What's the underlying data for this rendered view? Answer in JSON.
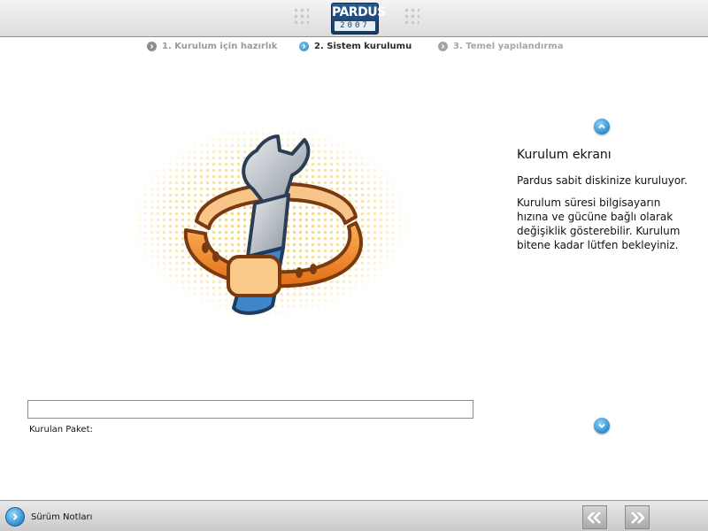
{
  "header": {
    "logo_name": "PARDUS",
    "logo_year": "2007"
  },
  "steps": [
    {
      "label": "1. Kurulum için hazırlık",
      "state": "done"
    },
    {
      "label": "2. Sistem kurulumu",
      "state": "active"
    },
    {
      "label": "3. Temel yapılandırma",
      "state": "pending"
    }
  ],
  "illustration": {
    "icon": "wrench-with-strap-icon"
  },
  "info": {
    "title": "Kurulum ekranı",
    "paragraph1": "Pardus sabit diskinize kuruluyor.",
    "paragraph2": "Kurulum süresi bilgisayarın hızına ve gücüne bağlı olarak değişiklik gösterebilir. Kurulum bitene kadar lütfen bekleyiniz."
  },
  "progress": {
    "value": 0,
    "package_label": "Kurulan Paket:"
  },
  "footer": {
    "release_notes_label": "Sürüm Notları"
  },
  "colors": {
    "accent": "#2a87c6",
    "logo_blue": "#163b66",
    "strap_orange": "#f08a24",
    "wrench_steel": "#9aa3ad"
  }
}
